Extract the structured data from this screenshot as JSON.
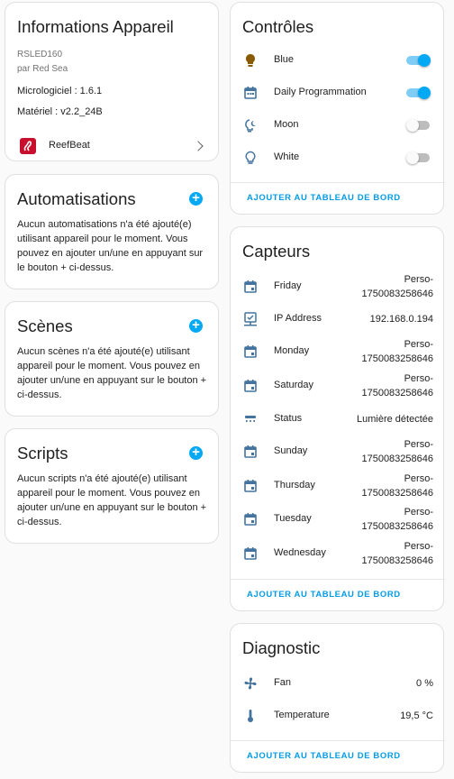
{
  "device_info": {
    "title": "Informations Appareil",
    "model": "RSLED160",
    "manufacturer": "par Red Sea",
    "firmware": "Micrologiciel : 1.6.1",
    "hardware": "Matériel : v2.2_24B",
    "integration": "ReefBeat"
  },
  "automations": {
    "title": "Automatisations",
    "text": "Aucun automatisations n'a été ajouté(e) utilisant appareil pour le moment. Vous pouvez en ajouter un/une en appuyant sur le bouton + ci-dessus."
  },
  "scenes": {
    "title": "Scènes",
    "text": "Aucun scènes n'a été ajouté(e) utilisant appareil pour le moment. Vous pouvez en ajouter un/une en appuyant sur le bouton + ci-dessus."
  },
  "scripts": {
    "title": "Scripts",
    "text": "Aucun scripts n'a été ajouté(e) utilisant appareil pour le moment. Vous pouvez en ajouter un/une en appuyant sur le bouton + ci-dessus."
  },
  "controls": {
    "title": "Contrôles",
    "items": [
      {
        "label": "Blue",
        "icon": "lightbulb-icon",
        "state": true
      },
      {
        "label": "Daily Programmation",
        "icon": "calendar-icon",
        "state": true
      },
      {
        "label": "Moon",
        "icon": "moon-bulb-icon",
        "state": false
      },
      {
        "label": "White",
        "icon": "lightbulb-outline-icon",
        "state": false
      }
    ],
    "footer": "AJOUTER AU TABLEAU DE BORD"
  },
  "sensors": {
    "title": "Capteurs",
    "items": [
      {
        "label": "Friday",
        "icon": "calendar-icon",
        "value": "Perso-\n1750083258646"
      },
      {
        "label": "IP Address",
        "icon": "ip-network-icon",
        "value": "192.168.0.194"
      },
      {
        "label": "Monday",
        "icon": "calendar-icon",
        "value": "Perso-\n1750083258646"
      },
      {
        "label": "Saturday",
        "icon": "calendar-icon",
        "value": "Perso-\n1750083258646"
      },
      {
        "label": "Status",
        "icon": "ceiling-light-icon",
        "value": "Lumière détectée"
      },
      {
        "label": "Sunday",
        "icon": "calendar-icon",
        "value": "Perso-\n1750083258646"
      },
      {
        "label": "Thursday",
        "icon": "calendar-icon",
        "value": "Perso-\n1750083258646"
      },
      {
        "label": "Tuesday",
        "icon": "calendar-icon",
        "value": "Perso-\n1750083258646"
      },
      {
        "label": "Wednesday",
        "icon": "calendar-icon",
        "value": "Perso-\n1750083258646"
      }
    ],
    "footer": "AJOUTER AU TABLEAU DE BORD"
  },
  "diagnostic": {
    "title": "Diagnostic",
    "items": [
      {
        "label": "Fan",
        "icon": "fan-icon",
        "value": "0 %"
      },
      {
        "label": "Temperature",
        "icon": "thermometer-icon",
        "value": "19,5 °C"
      }
    ],
    "footer": "AJOUTER AU TABLEAU DE BORD"
  },
  "colors": {
    "accent": "#03a9f4",
    "icon": "#44739e",
    "bulb_on": "#8a5a00"
  }
}
